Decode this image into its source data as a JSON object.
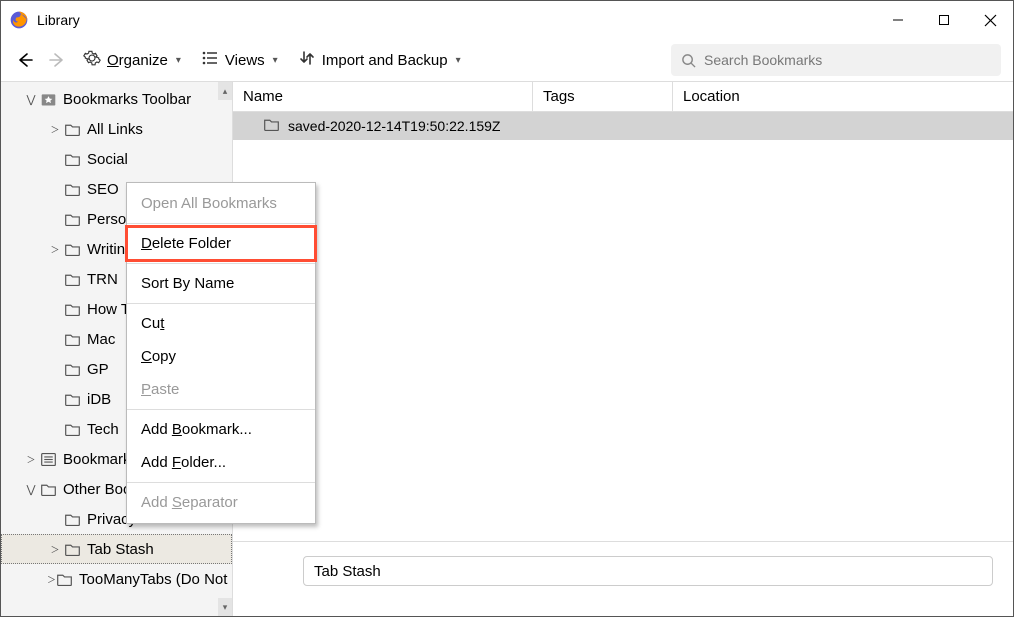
{
  "window": {
    "title": "Library"
  },
  "toolbar": {
    "organize": "Organize",
    "views": "Views",
    "import_backup": "Import and Backup",
    "search_placeholder": "Search Bookmarks"
  },
  "sidebar": {
    "items": [
      {
        "label": "Bookmarks Toolbar",
        "indent": 0,
        "expander": "down",
        "icon": "star-folder"
      },
      {
        "label": "All Links",
        "indent": 1,
        "expander": "right",
        "icon": "folder"
      },
      {
        "label": "Social",
        "indent": 1,
        "expander": "",
        "icon": "folder"
      },
      {
        "label": "SEO",
        "indent": 1,
        "expander": "",
        "icon": "folder"
      },
      {
        "label": "Personal",
        "indent": 1,
        "expander": "",
        "icon": "folder"
      },
      {
        "label": "Writing",
        "indent": 1,
        "expander": "right",
        "icon": "folder"
      },
      {
        "label": "TRN",
        "indent": 1,
        "expander": "",
        "icon": "folder"
      },
      {
        "label": "How To",
        "indent": 1,
        "expander": "",
        "icon": "folder"
      },
      {
        "label": "Mac",
        "indent": 1,
        "expander": "",
        "icon": "folder"
      },
      {
        "label": "GP",
        "indent": 1,
        "expander": "",
        "icon": "folder"
      },
      {
        "label": "iDB",
        "indent": 1,
        "expander": "",
        "icon": "folder"
      },
      {
        "label": "Tech",
        "indent": 1,
        "expander": "",
        "icon": "folder"
      },
      {
        "label": "Bookmarks Menu",
        "indent": 0,
        "expander": "right",
        "icon": "menu-folder"
      },
      {
        "label": "Other Bookmarks",
        "indent": 0,
        "expander": "down",
        "icon": "folder"
      },
      {
        "label": "Privacy",
        "indent": 1,
        "expander": "",
        "icon": "folder"
      },
      {
        "label": "Tab Stash",
        "indent": 1,
        "expander": "right",
        "icon": "folder",
        "selected": true
      },
      {
        "label": "TooManyTabs (Do Not Delete!)",
        "indent": 1,
        "expander": "right",
        "icon": "folder"
      }
    ]
  },
  "columns": {
    "name": "Name",
    "tags": "Tags",
    "location": "Location"
  },
  "list": {
    "rows": [
      {
        "label": "saved-2020-12-14T19:50:22.159Z"
      }
    ]
  },
  "details": {
    "name_value": "Tab Stash"
  },
  "context_menu": {
    "items": [
      {
        "label": "Open All Bookmarks",
        "disabled": true
      },
      {
        "separator": true
      },
      {
        "prefix": "D",
        "rest": "elete Folder",
        "highlighted": true
      },
      {
        "separator": true
      },
      {
        "label": "Sort By Name"
      },
      {
        "separator": true
      },
      {
        "prefix": "",
        "rest": "Cu",
        "u": "t",
        "tail": ""
      },
      {
        "prefix": "C",
        "rest": "opy"
      },
      {
        "prefix": "P",
        "rest": "aste",
        "disabled": true
      },
      {
        "separator": true
      },
      {
        "label_pre": "Add ",
        "u": "B",
        "label_post": "ookmark..."
      },
      {
        "label_pre": "Add ",
        "u": "F",
        "label_post": "older..."
      },
      {
        "separator": true
      },
      {
        "label_pre": "Add ",
        "u": "S",
        "label_post": "eparator",
        "disabled": true
      }
    ]
  }
}
